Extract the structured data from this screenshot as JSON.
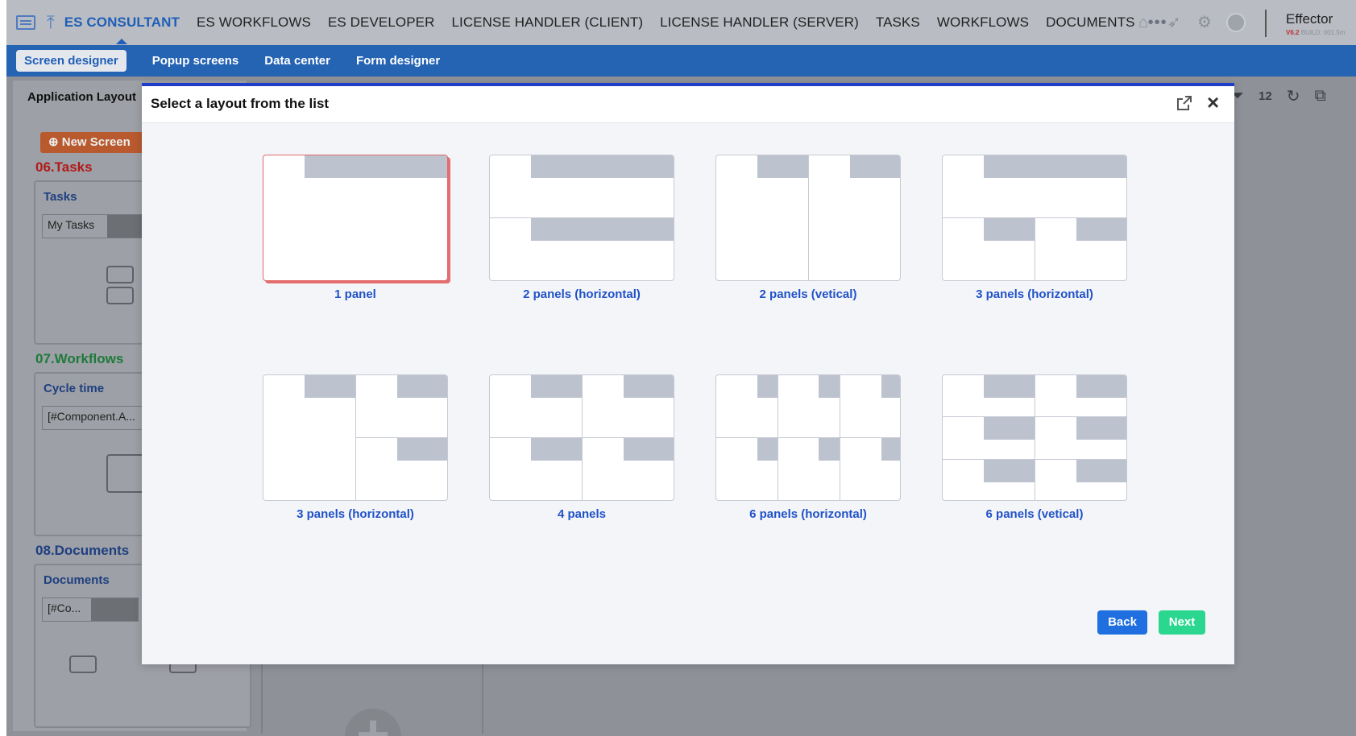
{
  "topnav": {
    "active_item": "ES CONSULTANT",
    "items": [
      "ES WORKFLOWS",
      "ES DEVELOPER",
      "LICENSE HANDLER (CLIENT)",
      "LICENSE HANDLER (SERVER)",
      "TASKS",
      "WORKFLOWS",
      "DOCUMENTS"
    ],
    "more": "•••",
    "brand_name": "Effector",
    "brand_version": "V6.2",
    "brand_build": "BUILD: 001.5m"
  },
  "subnav": {
    "items": [
      "Screen designer",
      "Popup screens",
      "Data center",
      "Form designer"
    ]
  },
  "workspace": {
    "tab_label": "Application Layout",
    "new_screen_label": "New Screen",
    "page_size": "12",
    "sections": [
      {
        "heading": "06.Tasks",
        "color": "#b11a1a",
        "card_title": "Tasks",
        "field": "My Tasks"
      },
      {
        "heading": "07.Workflows",
        "color": "#1f7a3a",
        "card_title": "Cycle time",
        "field": "[#Component.A..."
      },
      {
        "heading": "08.Documents",
        "color": "#1e3f80",
        "card_title": "Documents",
        "field": "[#Co..."
      }
    ]
  },
  "modal": {
    "title": "Select a layout from the list",
    "back_label": "Back",
    "next_label": "Next",
    "selected_index": 0,
    "layouts": [
      {
        "label": "1 panel",
        "selected": true
      },
      {
        "label": "2 panels (horizontal)",
        "selected": false
      },
      {
        "label": "2 panels (vetical)",
        "selected": false
      },
      {
        "label": "3 panels (horizontal)",
        "selected": false
      },
      {
        "label": "3 panels (horizontal)",
        "selected": false
      },
      {
        "label": "4 panels",
        "selected": false
      },
      {
        "label": "6 panels (horizontal)",
        "selected": false
      },
      {
        "label": "6 panels (vetical)",
        "selected": false
      }
    ]
  },
  "colors": {
    "accent_blue": "#2563b3",
    "selection_red": "#e66d6d",
    "next_green": "#2bd68e",
    "back_blue": "#1f6fe0"
  }
}
